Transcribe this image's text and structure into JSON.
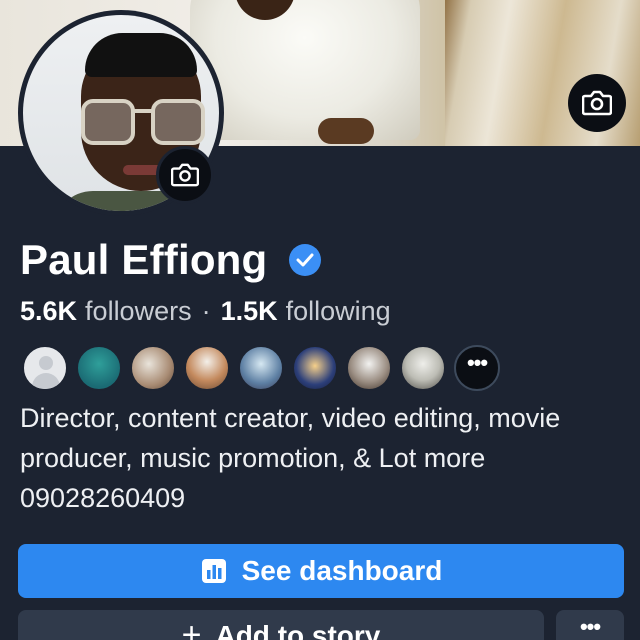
{
  "profile": {
    "name": "Paul Effiong",
    "verified": true,
    "accent_color": "#2d88f0",
    "verified_color": "#3b8ff5"
  },
  "stats": {
    "followers_count": "5.6K",
    "followers_label": "followers",
    "separator": "·",
    "following_count": "1.5K",
    "following_label": "following"
  },
  "friends": {
    "more_glyph": "•••"
  },
  "bio": {
    "text": "Director, content creator, video editing, movie producer, music promotion, & Lot more 09028260409"
  },
  "actions": {
    "dashboard_label": "See dashboard",
    "dashboard_icon": "dashboard-icon",
    "story_plus": "+",
    "story_label": "Add to story",
    "more_glyph": "•••"
  },
  "icons": {
    "cover_camera": "camera-icon",
    "avatar_camera": "camera-icon",
    "verified": "verified-badge-icon"
  }
}
